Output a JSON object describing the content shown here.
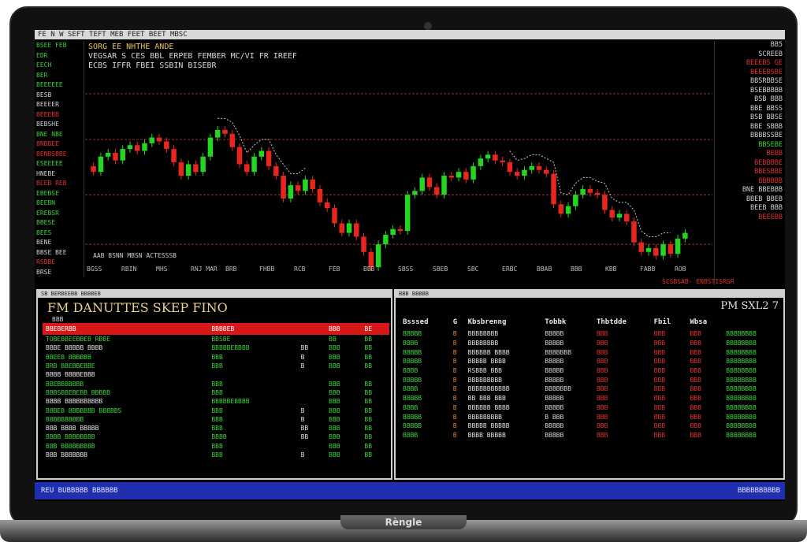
{
  "device": {
    "brand_label": "Rèngle"
  },
  "topbar": {
    "text": "FE N  W  SEFT  TEFT  MEB  FEET  BEET  MBSC"
  },
  "chart": {
    "header_lines": [
      "SORG EE NHTHE ANDE",
      "VEGSAR  S CES  BBL  ERPEB  FEMBER  MC/VI  FR  IREEF",
      "ECBS  IFFR  FBEI  SSBIN  BISEBR"
    ],
    "bottom_label": "AAB  BSNN  MBSN  ACTESSSB",
    "axis_labels": [
      "BGSS",
      "RBIN",
      "MHS",
      "RNJ  MAR",
      "BRB",
      "FHBB",
      "RCB",
      "FEB",
      "BBB",
      "SBSS",
      "SBEB",
      "SBC",
      "ERBC",
      "BBAB",
      "BBB",
      "KBB",
      "FABB",
      "ROB"
    ],
    "bottom_right": "SCSBSAB-  ENBSTISRSR"
  },
  "chart_data": {
    "type": "candlestick",
    "title": "",
    "xlabel": "",
    "ylabel": "",
    "ylim": [
      0,
      100
    ],
    "candles": [
      {
        "o": 55,
        "c": 52
      },
      {
        "o": 52,
        "c": 60
      },
      {
        "o": 60,
        "c": 62
      },
      {
        "o": 62,
        "c": 58
      },
      {
        "o": 58,
        "c": 64
      },
      {
        "o": 64,
        "c": 66
      },
      {
        "o": 66,
        "c": 63
      },
      {
        "o": 63,
        "c": 67
      },
      {
        "o": 67,
        "c": 70
      },
      {
        "o": 70,
        "c": 68
      },
      {
        "o": 68,
        "c": 64
      },
      {
        "o": 64,
        "c": 57
      },
      {
        "o": 57,
        "c": 50
      },
      {
        "o": 50,
        "c": 56
      },
      {
        "o": 56,
        "c": 52
      },
      {
        "o": 52,
        "c": 60
      },
      {
        "o": 60,
        "c": 70
      },
      {
        "o": 70,
        "c": 74
      },
      {
        "o": 74,
        "c": 72
      },
      {
        "o": 72,
        "c": 65
      },
      {
        "o": 65,
        "c": 56
      },
      {
        "o": 56,
        "c": 52
      },
      {
        "o": 52,
        "c": 60
      },
      {
        "o": 60,
        "c": 63
      },
      {
        "o": 63,
        "c": 55
      },
      {
        "o": 55,
        "c": 50
      },
      {
        "o": 50,
        "c": 38
      },
      {
        "o": 38,
        "c": 45
      },
      {
        "o": 45,
        "c": 42
      },
      {
        "o": 42,
        "c": 48
      },
      {
        "o": 48,
        "c": 43
      },
      {
        "o": 43,
        "c": 36
      },
      {
        "o": 36,
        "c": 33
      },
      {
        "o": 33,
        "c": 25
      },
      {
        "o": 25,
        "c": 20
      },
      {
        "o": 20,
        "c": 25
      },
      {
        "o": 25,
        "c": 18
      },
      {
        "o": 18,
        "c": 10
      },
      {
        "o": 10,
        "c": 2
      },
      {
        "o": 2,
        "c": 14
      },
      {
        "o": 14,
        "c": 19
      },
      {
        "o": 19,
        "c": 22
      },
      {
        "o": 22,
        "c": 21
      },
      {
        "o": 21,
        "c": 40
      },
      {
        "o": 40,
        "c": 42
      },
      {
        "o": 42,
        "c": 49
      },
      {
        "o": 49,
        "c": 44
      },
      {
        "o": 44,
        "c": 40
      },
      {
        "o": 40,
        "c": 50
      },
      {
        "o": 50,
        "c": 49
      },
      {
        "o": 49,
        "c": 52
      },
      {
        "o": 52,
        "c": 48
      },
      {
        "o": 48,
        "c": 55
      },
      {
        "o": 55,
        "c": 59
      },
      {
        "o": 59,
        "c": 61
      },
      {
        "o": 61,
        "c": 58
      },
      {
        "o": 58,
        "c": 57
      },
      {
        "o": 57,
        "c": 52
      },
      {
        "o": 52,
        "c": 50
      },
      {
        "o": 50,
        "c": 53
      },
      {
        "o": 53,
        "c": 55
      },
      {
        "o": 55,
        "c": 53
      },
      {
        "o": 53,
        "c": 51
      },
      {
        "o": 51,
        "c": 35
      },
      {
        "o": 35,
        "c": 30
      },
      {
        "o": 30,
        "c": 34
      },
      {
        "o": 34,
        "c": 40
      },
      {
        "o": 40,
        "c": 43
      },
      {
        "o": 43,
        "c": 41
      },
      {
        "o": 41,
        "c": 40
      },
      {
        "o": 40,
        "c": 32
      },
      {
        "o": 32,
        "c": 28
      },
      {
        "o": 28,
        "c": 30
      },
      {
        "o": 30,
        "c": 26
      },
      {
        "o": 26,
        "c": 15
      },
      {
        "o": 15,
        "c": 10
      },
      {
        "o": 10,
        "c": 12
      },
      {
        "o": 12,
        "c": 8
      },
      {
        "o": 8,
        "c": 14
      },
      {
        "o": 14,
        "c": 9
      },
      {
        "o": 9,
        "c": 17
      },
      {
        "o": 17,
        "c": 20
      }
    ],
    "hlines": [
      93,
      69,
      40,
      14
    ]
  },
  "left_panel": {
    "lines": [
      {
        "t": "BSEE FEB",
        "c": "#3ad13a"
      },
      {
        "t": "EDR",
        "c": "#3ad13a"
      },
      {
        "t": "EECH",
        "c": "#3ad13a"
      },
      {
        "t": "BER",
        "c": "#3ad13a"
      },
      {
        "t": "BEEEEEE",
        "c": "#3ad13a"
      },
      {
        "t": "BESB",
        "c": "#d0d0d0"
      },
      {
        "t": "BEEEER",
        "c": "#d0d0d0"
      },
      {
        "t": "BEEEBB",
        "c": "#e03030"
      },
      {
        "t": "BEBSHE",
        "c": "#d0d0d0"
      },
      {
        "t": "BNE NBE",
        "c": "#3ad13a"
      },
      {
        "t": "BNBBEE",
        "c": "#e03030"
      },
      {
        "t": "BENBSBBE",
        "c": "#e03030"
      },
      {
        "t": "ESEEEEE",
        "c": "#3ad13a"
      },
      {
        "t": "HNEBE",
        "c": "#d0d0d0"
      },
      {
        "t": "BCEB REB",
        "c": "#e03030"
      },
      {
        "t": "EBEBSE",
        "c": "#3ad13a"
      },
      {
        "t": "BEEBN",
        "c": "#3ad13a"
      },
      {
        "t": "EREBSR",
        "c": "#3ad13a"
      },
      {
        "t": "BBESE",
        "c": "#3ad13a"
      },
      {
        "t": "BEES",
        "c": "#3ad13a"
      },
      {
        "t": "BENE",
        "c": "#d0d0d0"
      },
      {
        "t": "BBSE BEE",
        "c": "#d0d0d0"
      },
      {
        "t": "RSBBE",
        "c": "#e03030"
      },
      {
        "t": "BRSE",
        "c": "#d0d0d0"
      }
    ]
  },
  "right_panel": {
    "lines": [
      {
        "t": "BB5",
        "c": "#d0d0d0"
      },
      {
        "t": "SCREEB",
        "c": "#d0d0d0"
      },
      {
        "t": "",
        "c": "#d0d0d0"
      },
      {
        "t": "BEEEBS GE",
        "c": "#e03030"
      },
      {
        "t": "BEEEBSBE",
        "c": "#e03030"
      },
      {
        "t": "BBSRBBSE",
        "c": "#d0d0d0"
      },
      {
        "t": "BSEBBBBB",
        "c": "#d0d0d0"
      },
      {
        "t": "BSB  BBB",
        "c": "#d0d0d0"
      },
      {
        "t": "BBE  BBSS",
        "c": "#d0d0d0"
      },
      {
        "t": "BSB  BBSE",
        "c": "#d0d0d0"
      },
      {
        "t": "BBE  SBBB",
        "c": "#d0d0d0"
      },
      {
        "t": "BBBBSSBE",
        "c": "#d0d0d0"
      },
      {
        "t": "",
        "c": "#d0d0d0"
      },
      {
        "t": "BBSEBE",
        "c": "#3ad13a"
      },
      {
        "t": "BEBB",
        "c": "#e03030"
      },
      {
        "t": "BEBBBBE",
        "c": "#e03030"
      },
      {
        "t": "BBESBBE",
        "c": "#e03030"
      },
      {
        "t": "",
        "c": "#d0d0d0"
      },
      {
        "t": "BBBBBB",
        "c": "#e03030"
      },
      {
        "t": "BNE  BBEBBB",
        "c": "#d0d0d0"
      },
      {
        "t": "BBEB  BBEB",
        "c": "#d0d0d0"
      },
      {
        "t": "BEEB  BBB",
        "c": "#d0d0d0"
      },
      {
        "t": "BEEEBB",
        "c": "#e03030"
      }
    ]
  },
  "left_window": {
    "titlebar": "SB BERBEEBB BBBBEB",
    "big_title": "FM  DANUTTES SKEP FINO",
    "sub": "BBB",
    "header": [
      "BBEBERBB",
      "BBBBEB",
      "",
      "BBB",
      "BE"
    ],
    "rows": [
      [
        "TOBEBBEEBBEB  RBBE",
        "BBSBE",
        "",
        "BB",
        "BB"
      ],
      [
        "BBBE  BBBBB  BBBB",
        "BBBBBEBBBB",
        "BB",
        "BBB",
        "BB"
      ],
      [
        "BBEEB  BBBBBB",
        "BBB",
        "B",
        "BBB",
        "BB"
      ],
      [
        "BRB  BBEBBEBBE",
        "BBB",
        "B",
        "BBB",
        "BB"
      ],
      [
        "BBBB BBBBEBBB",
        "",
        "",
        "",
        ""
      ],
      [
        "BBEBBBBBBB",
        "BBB",
        "",
        "BBB",
        "BB"
      ],
      [
        "BBBSBBEBEBB  BBBBB",
        "BBB",
        "",
        "BBB",
        "BB"
      ],
      [
        "BBBB  BBBBBBBBBB",
        "BBBBBEBBBB",
        "",
        "BBB",
        "BB"
      ],
      [
        "BBBEB  BBBBBBB BBBBBS",
        "BBB",
        "B",
        "BBB",
        "BB"
      ],
      [
        "BBBBBBBBBB",
        "BBB",
        "B",
        "BBB",
        "BB"
      ],
      [
        "BBB BBBB BBBBB",
        "BBB",
        "BB",
        "BBB",
        "BB"
      ],
      [
        "BBBB BBBBBBBB",
        "BBBB",
        "BB",
        "BBB",
        "BB"
      ],
      [
        "BBB  BBBBBBBBB",
        "BBB",
        "",
        "BBB",
        "BB"
      ],
      [
        "BBB BBBBBBB",
        "BBB",
        "B",
        "BBB",
        "BB"
      ]
    ]
  },
  "right_window": {
    "titlebar": "BBB BBBBB",
    "corner": "PM  SXL2 7",
    "headers": [
      "Bsssed",
      "G",
      "Kbsbrenng",
      "Tobbk",
      "Thbtdde",
      "Fbil",
      "Wbsa",
      ""
    ],
    "rows": [
      [
        "BBBBB",
        "B",
        "BBBBBBBB",
        "BBBBB",
        "BBB",
        "BBB",
        "BBB",
        "BBBBBBBB"
      ],
      [
        "BBBB",
        "B",
        "BBBBBBBB",
        "BBBBB",
        "BBB",
        "BBB",
        "BBB",
        "BBBBBBBB"
      ],
      [
        "BBBBB",
        "B",
        "BBBBBB BBBB",
        "BBBBBBB",
        "BBB",
        "BBB",
        "BBB",
        "BBBBBBBB"
      ],
      [
        "BBBBB",
        "B",
        "BBBBB BBBB",
        "BBBBB",
        "BBB",
        "BBB",
        "BBB",
        "BBBBBBBB"
      ],
      [
        "BBBB",
        "B",
        "RSBBB BBB",
        "BBBBB",
        "BBB",
        "BBB",
        "BBB",
        "BBBBBBBB"
      ],
      [
        "BBBBB",
        "B",
        "BBBBBBBBB",
        "BBBBB",
        "BBB",
        "BBB",
        "BBB",
        "BBBBBBBB"
      ],
      [
        "BBBB",
        "B",
        "BBBBBBBBBBB",
        "BBBBBBB",
        "BBB",
        "BBB",
        "BBB",
        "BBBBBBBB"
      ],
      [
        "BBBBB",
        "B",
        "BB BBB BBB",
        "BBBBB",
        "BBB",
        "BBB",
        "BBB",
        "BBBBBBBB"
      ],
      [
        "BBBB",
        "B",
        "BBBBBB BBBB",
        "BBBBB",
        "BBB",
        "BBB",
        "BBB",
        "BBBBBBBB"
      ],
      [
        "BBBBB",
        "B",
        "BBBBBBBBB",
        "B BBB",
        "BBB",
        "BBB",
        "BBB",
        "BBBBBBBB"
      ],
      [
        "BBBBB",
        "B",
        "BBBBB BBBBB",
        "BBBBB",
        "BBB",
        "BBB",
        "BBB",
        "BBBBBBBB"
      ],
      [
        "BBBB",
        "B",
        "BBBB BBBBB",
        "BBBBB",
        "BBB",
        "BBB",
        "BBB",
        "BBBBBBBB"
      ]
    ]
  },
  "status": {
    "left": "REU  BUBBBBB BBBBBB",
    "right": "BBBBBBBBBB"
  },
  "colors": {
    "up": "#22d622",
    "down": "#e8261e",
    "grid": "#a03030",
    "status_bg": "#1f2fb0",
    "alert_bar": "#d81818"
  }
}
